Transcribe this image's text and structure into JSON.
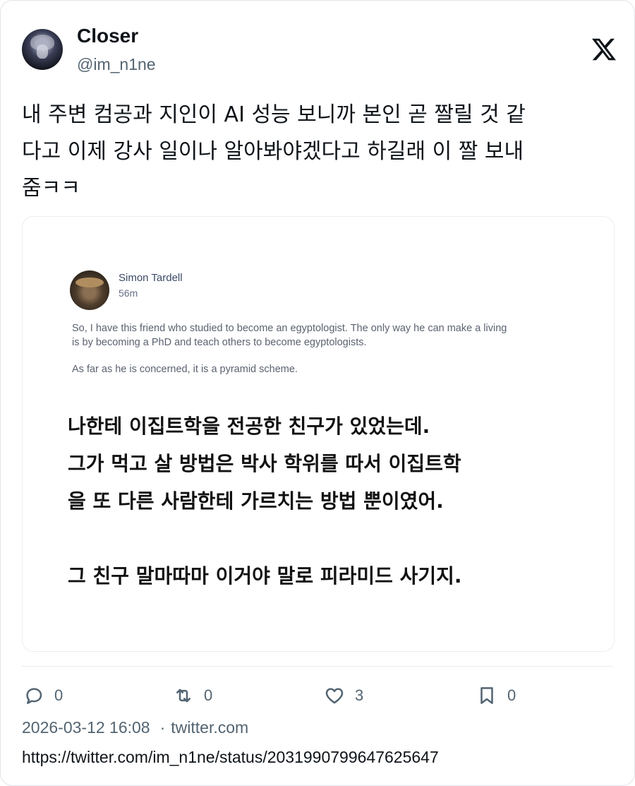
{
  "tweet": {
    "author_name": "Closer",
    "author_handle": "@im_n1ne",
    "text": "내 주변 컴공과 지인이 AI 성능 보니까 본인 곧 짤릴 것 같\n다고 이제 강사 일이나 알아봐야겠다고 하길래 이 짤 보내\n줌ㅋㅋ",
    "icons": {
      "logo": "x-logo-icon",
      "reply": "reply-icon",
      "retweet": "retweet-icon",
      "like": "heart-icon",
      "bookmark": "bookmark-icon"
    }
  },
  "embedded_image": {
    "author_name": "Simon Tardell",
    "time": "56m",
    "paragraph1": "So, I have this friend who studied to become an egyptologist. The only way he can make a living is by becoming a PhD and teach others to become egyptologists.",
    "paragraph2": "As far as he is concerned, it is a pyramid scheme.",
    "korean_translation": "나한테 이집트학을 전공한 친구가 있었는데.\n그가 먹고 살 방법은 박사 학위를 따서 이집트학\n을 또 다른 사람한테 가르치는 방법 뿐이였어.\n\n그 친구 말마따마 이거야 말로 피라미드 사기지."
  },
  "actions": {
    "reply_count": "0",
    "retweet_count": "0",
    "like_count": "3",
    "bookmark_count": "0"
  },
  "footer": {
    "timestamp": "2026-03-12 16:08",
    "separator": "·",
    "source": "twitter.com",
    "url": "https://twitter.com/im_n1ne/status/2031990799647625647"
  },
  "colors": {
    "text_primary": "#0f1419",
    "text_secondary": "#536471",
    "border": "#e1e4e8"
  }
}
